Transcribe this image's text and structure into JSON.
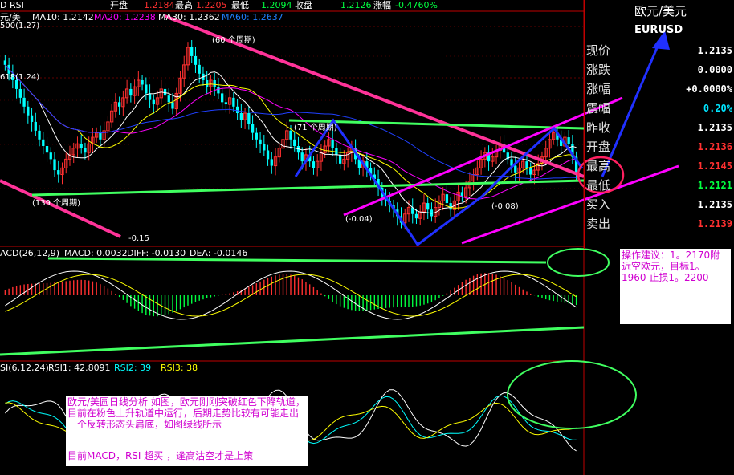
{
  "header": {
    "symbol_label": "D RSI",
    "open_label": "开盘",
    "open_value": "1.2184",
    "high_label": "最高",
    "high_value": "1.2205",
    "low_label": "最低",
    "low_value": "1.2094",
    "close_label": "收盘",
    "close_value": "1.2126",
    "change_label": "涨幅",
    "change_value": "-0.4760%"
  },
  "ma_legend": {
    "name": "元/美",
    "ma10": "MA10: 1.2142",
    "ma20": "MA20: 1.2238",
    "ma30": "MA30: 1.2362",
    "ma60": "MA60: 1.2637"
  },
  "side_panel": {
    "title": "欧元/美元",
    "code": "EURUSD",
    "rows": [
      {
        "label": "现价",
        "value": "1.2135",
        "color": "#ffffff"
      },
      {
        "label": "涨跌",
        "value": "0.0000",
        "color": "#ffffff"
      },
      {
        "label": "涨幅",
        "value": "+0.0000%",
        "color": "#ffffff"
      },
      {
        "label": "震幅",
        "value": "0.20%",
        "color": "#00e5ff"
      },
      {
        "label": "昨收",
        "value": "1.2135",
        "color": "#ffffff"
      },
      {
        "label": "开盘",
        "value": "1.2136",
        "color": "#ff3030"
      },
      {
        "label": "最高",
        "value": "1.2145",
        "color": "#ff3030"
      },
      {
        "label": "最低",
        "value": "1.2121",
        "color": "#00ff40"
      },
      {
        "label": "买入",
        "value": "1.2135",
        "color": "#ffffff"
      },
      {
        "label": "卖出",
        "value": "1.2139",
        "color": "#ff3030"
      }
    ]
  },
  "main_annotations": {
    "fib_500": "500(1.27)",
    "fib_618": "618(1.24)",
    "period_60": "(60 个周期)",
    "period_71": "(71 个周期)",
    "period_139": "(139 个周期)",
    "val_neg015": "-0.15",
    "val_neg004": "(-0.04)",
    "val_neg008": "(-0.08)"
  },
  "macd_legend": {
    "label": "ACD(26,12,9)",
    "macd": "MACD: 0.0032",
    "diff": "DIFF: -0.0130",
    "dea": "DEA: -0.0146"
  },
  "rsi_legend": {
    "label": "SI(6,12,24)",
    "rsi1": "RSI1: 42.8091",
    "rsi2": "RSI2: 39",
    "rsi3": "RSI3: 38"
  },
  "notes": {
    "advice": "操作建议：1。2170附近空欧元，目标1。1960 止损1。2200",
    "analysis_line1": "欧元/美圆日线分析 如图，欧元刚刚突破红色下降轨道，目前在粉色上升轨道中运行，后期走势比较有可能走出一个反转形态头肩底，如图绿线所示",
    "analysis_line2": "目前MACD，RSI 超买 ，逢高沽空才是上策"
  },
  "colors": {
    "up_candle": "#ff3030",
    "down_candle": "#00ffff",
    "red_channel": "#ff3399",
    "pink_channel": "#ff00ff",
    "green_line": "#40ff60",
    "blue_arrow": "#2030ff",
    "ma10": "#ffffff",
    "ma20": "#ffff00",
    "ma30": "#ff00ff",
    "ma60": "#00ff00"
  },
  "chart_data": {
    "type": "candlestick",
    "title": "",
    "series_note": "EUR/USD daily candles with MA10/MA20/MA30/MA60, MACD and RSI sub-panels",
    "ylim": [
      1.18,
      1.285
    ],
    "closes": [
      1.262,
      1.258,
      1.255,
      1.251,
      1.247,
      1.243,
      1.239,
      1.236,
      1.232,
      1.228,
      1.225,
      1.222,
      1.219,
      1.214,
      1.212,
      1.215,
      1.219,
      1.221,
      1.224,
      1.226,
      1.224,
      1.222,
      1.226,
      1.229,
      1.231,
      1.228,
      1.232,
      1.236,
      1.241,
      1.245,
      1.243,
      1.247,
      1.251,
      1.248,
      1.252,
      1.255,
      1.253,
      1.249,
      1.246,
      1.244,
      1.247,
      1.251,
      1.248,
      1.245,
      1.242,
      1.249,
      1.256,
      1.262,
      1.27,
      1.266,
      1.262,
      1.258,
      1.255,
      1.252,
      1.255,
      1.252,
      1.249,
      1.245,
      1.244,
      1.247,
      1.243,
      1.24,
      1.237,
      1.24,
      1.235,
      1.231,
      1.228,
      1.226,
      1.223,
      1.219,
      1.216,
      1.22,
      1.224,
      1.228,
      1.232,
      1.228,
      1.225,
      1.222,
      1.218,
      1.221,
      1.218,
      1.215,
      1.218,
      1.222,
      1.225,
      1.228,
      1.224,
      1.221,
      1.217,
      1.219,
      1.222,
      1.224,
      1.219,
      1.215,
      1.218,
      1.215,
      1.212,
      1.21,
      1.206,
      1.202,
      1.2,
      1.198,
      1.196,
      1.193,
      1.19,
      1.194,
      1.197,
      1.194,
      1.192,
      1.195,
      1.199,
      1.196,
      1.193,
      1.197,
      1.2,
      1.203,
      1.199,
      1.196,
      1.2,
      1.204,
      1.202,
      1.206,
      1.209,
      1.212,
      1.215,
      1.219,
      1.222,
      1.218,
      1.22,
      1.223,
      1.226,
      1.222,
      1.219,
      1.216,
      1.213,
      1.215,
      1.218,
      1.215,
      1.212,
      1.214,
      1.217,
      1.22,
      1.224,
      1.228,
      1.231,
      1.228,
      1.225,
      1.229,
      1.226,
      1.22,
      1.2126
    ],
    "rsi_series": [
      {
        "name": "RSI1",
        "last": 42.8091
      },
      {
        "name": "RSI2",
        "last": 39
      },
      {
        "name": "RSI3",
        "last": 38
      }
    ],
    "macd": {
      "macd": 0.0032,
      "diff": -0.013,
      "dea": -0.0146
    }
  }
}
